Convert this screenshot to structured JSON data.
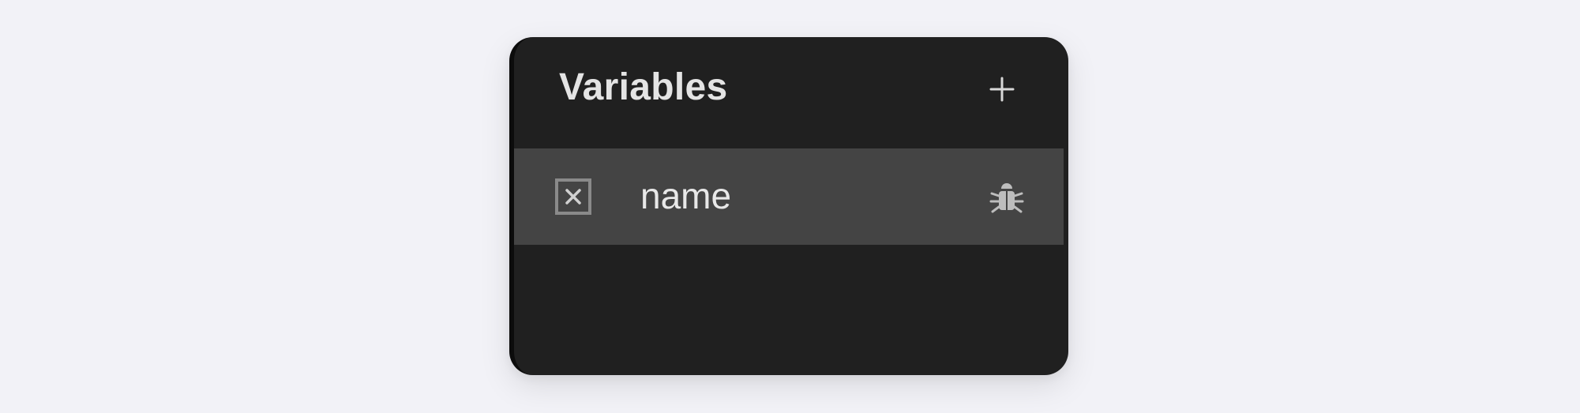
{
  "panel": {
    "title": "Variables",
    "add_icon": "plus-icon",
    "variables": [
      {
        "name": "name",
        "type_icon": "variable-x-icon",
        "action_icon": "bug-icon"
      }
    ]
  }
}
